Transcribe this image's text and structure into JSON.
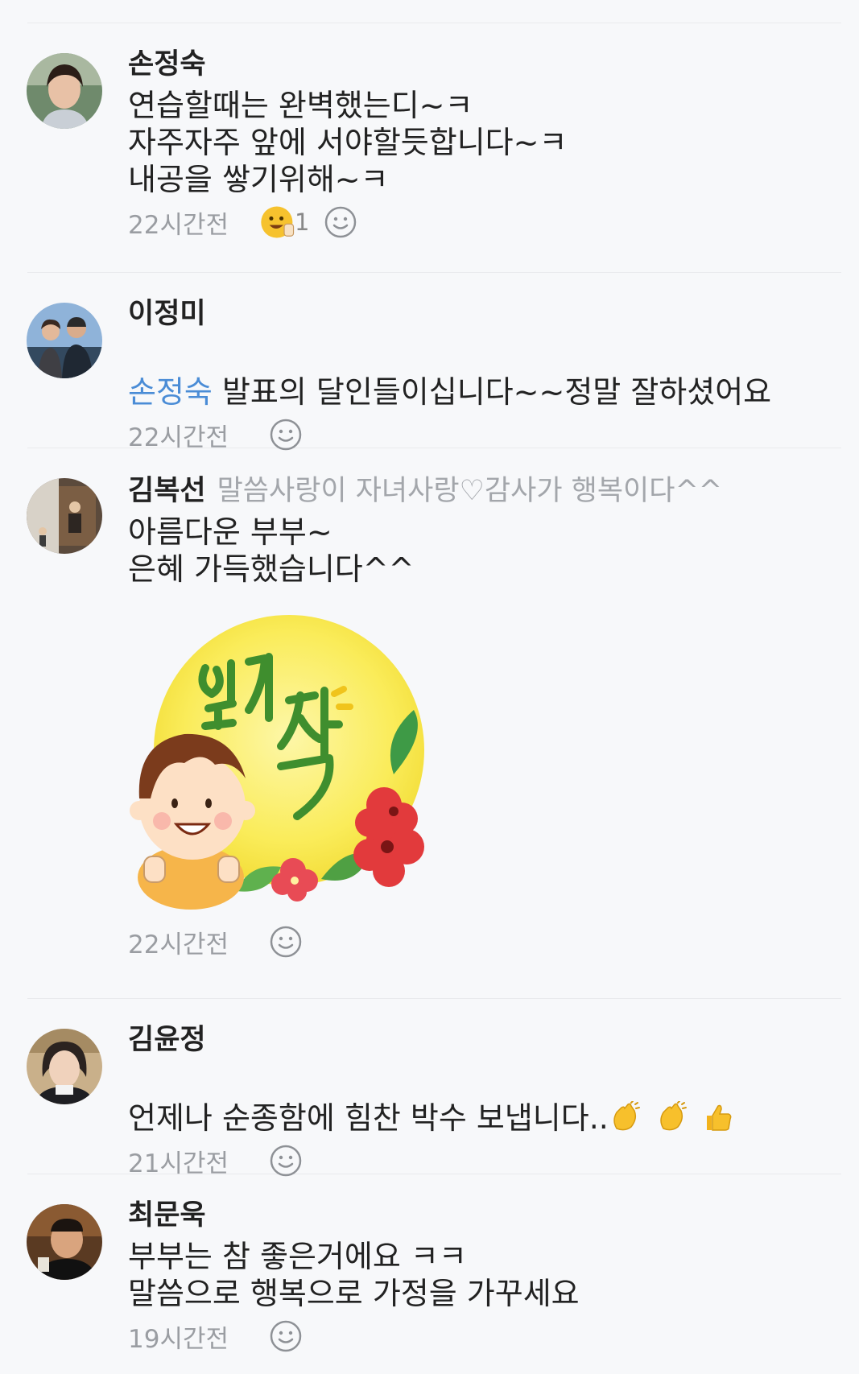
{
  "comments": [
    {
      "author": "손정숙",
      "lines": "연습할때는 완벽했는디~ㅋ\n자주자주 앞에 서야할듯합니다~ㅋ\n내공을 쌓기위해~ㅋ",
      "time": "22시간전",
      "reaction_count": "1"
    },
    {
      "author": "이정미",
      "mention": "손정숙",
      "text": " 발표의 달인들이십니다~~정말 잘하셨어요",
      "time": "22시간전"
    },
    {
      "author": "김복선",
      "bio": "말씀사랑이  자녀사랑♡감사가 행복이다^^",
      "lines": "아름다운 부부~\n은혜 가득했습니다^^",
      "sticker_text": "엄지척",
      "time": "22시간전"
    },
    {
      "author": "김윤정",
      "text": "언제나 순종함에 힘찬 박수 보냅니다..",
      "emojis": [
        "clapping-hands",
        "clapping-hands",
        "thumbs-up"
      ],
      "time": "21시간전"
    },
    {
      "author": "최문욱",
      "lines": "부부는 참 좋은거에요 ㅋㅋ\n말씀으로 행복으로 가정을 가꾸세요",
      "time": "19시간전"
    }
  ],
  "colors": {
    "background": "#f7f8fa",
    "mention": "#4a8cd6",
    "meta": "#9a9da2",
    "divider": "#e9eaed"
  }
}
